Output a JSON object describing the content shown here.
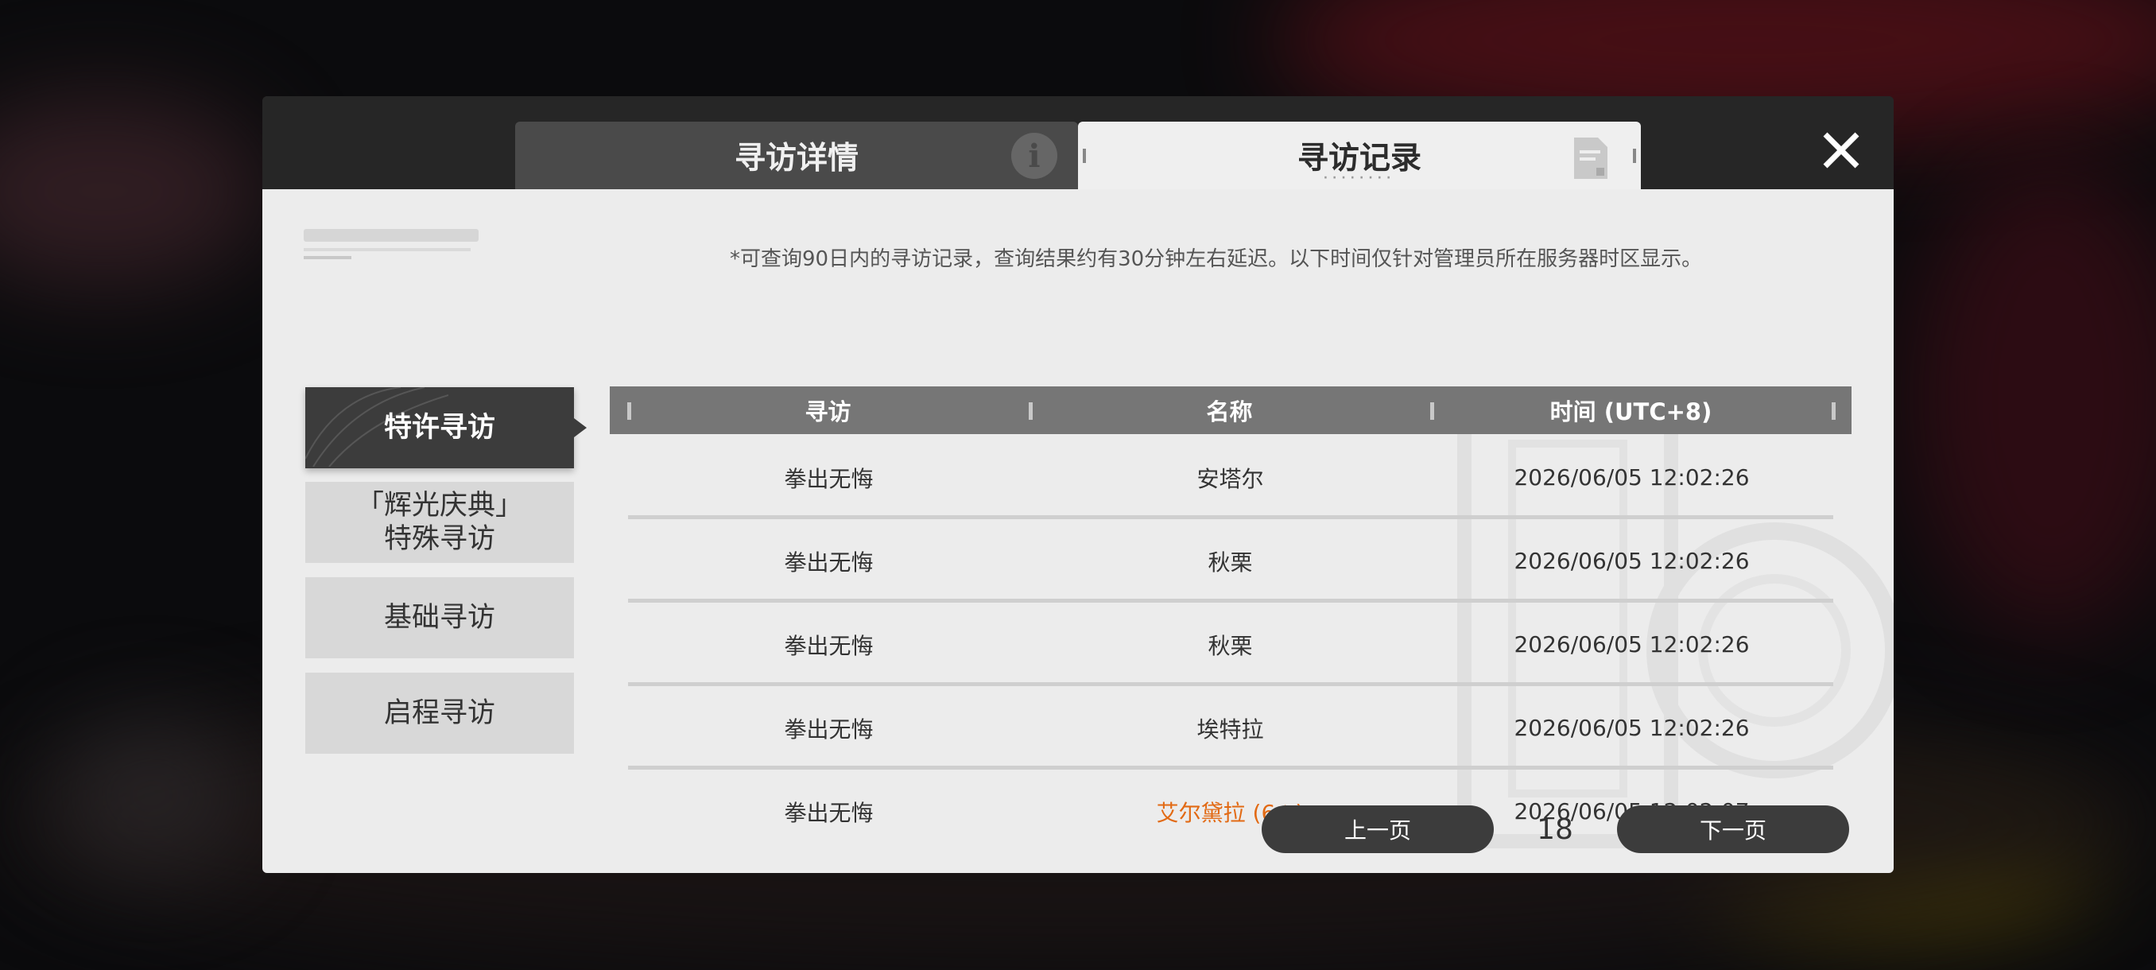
{
  "tabs": {
    "details_label": "寻访详情",
    "records_label": "寻访记录"
  },
  "sidebar": {
    "items": [
      {
        "label": "特许寻访",
        "active": true
      },
      {
        "label": "「辉光庆典」\n特殊寻访",
        "active": false
      },
      {
        "label": "基础寻访",
        "active": false
      },
      {
        "label": "启程寻访",
        "active": false
      }
    ]
  },
  "notice": "*可查询90日内的寻访记录，查询结果约有30分钟左右延迟。以下时间仅针对管理员所在服务器时区显示。",
  "table": {
    "headers": [
      "寻访",
      "名称",
      "时间 (UTC+8)"
    ],
    "rows": [
      {
        "pool": "拳出无悔",
        "name": "安塔尔",
        "time": "2026/06/05 12:02:26"
      },
      {
        "pool": "拳出无悔",
        "name": "秋栗",
        "time": "2026/06/05 12:02:26"
      },
      {
        "pool": "拳出无悔",
        "name": "秋栗",
        "time": "2026/06/05 12:02:26"
      },
      {
        "pool": "拳出无悔",
        "name": "埃特拉",
        "time": "2026/06/05 12:02:26"
      },
      {
        "pool": "拳出无悔",
        "name": "艾尔黛拉 (6★)",
        "time": "2026/06/05 12:02:07"
      }
    ]
  },
  "pagination": {
    "prev_label": "上一页",
    "page": "18",
    "next_label": "下一页"
  },
  "colors": {
    "highlight": "#e26a14",
    "dark": "#3c3c3c",
    "panel": "#ececec"
  }
}
